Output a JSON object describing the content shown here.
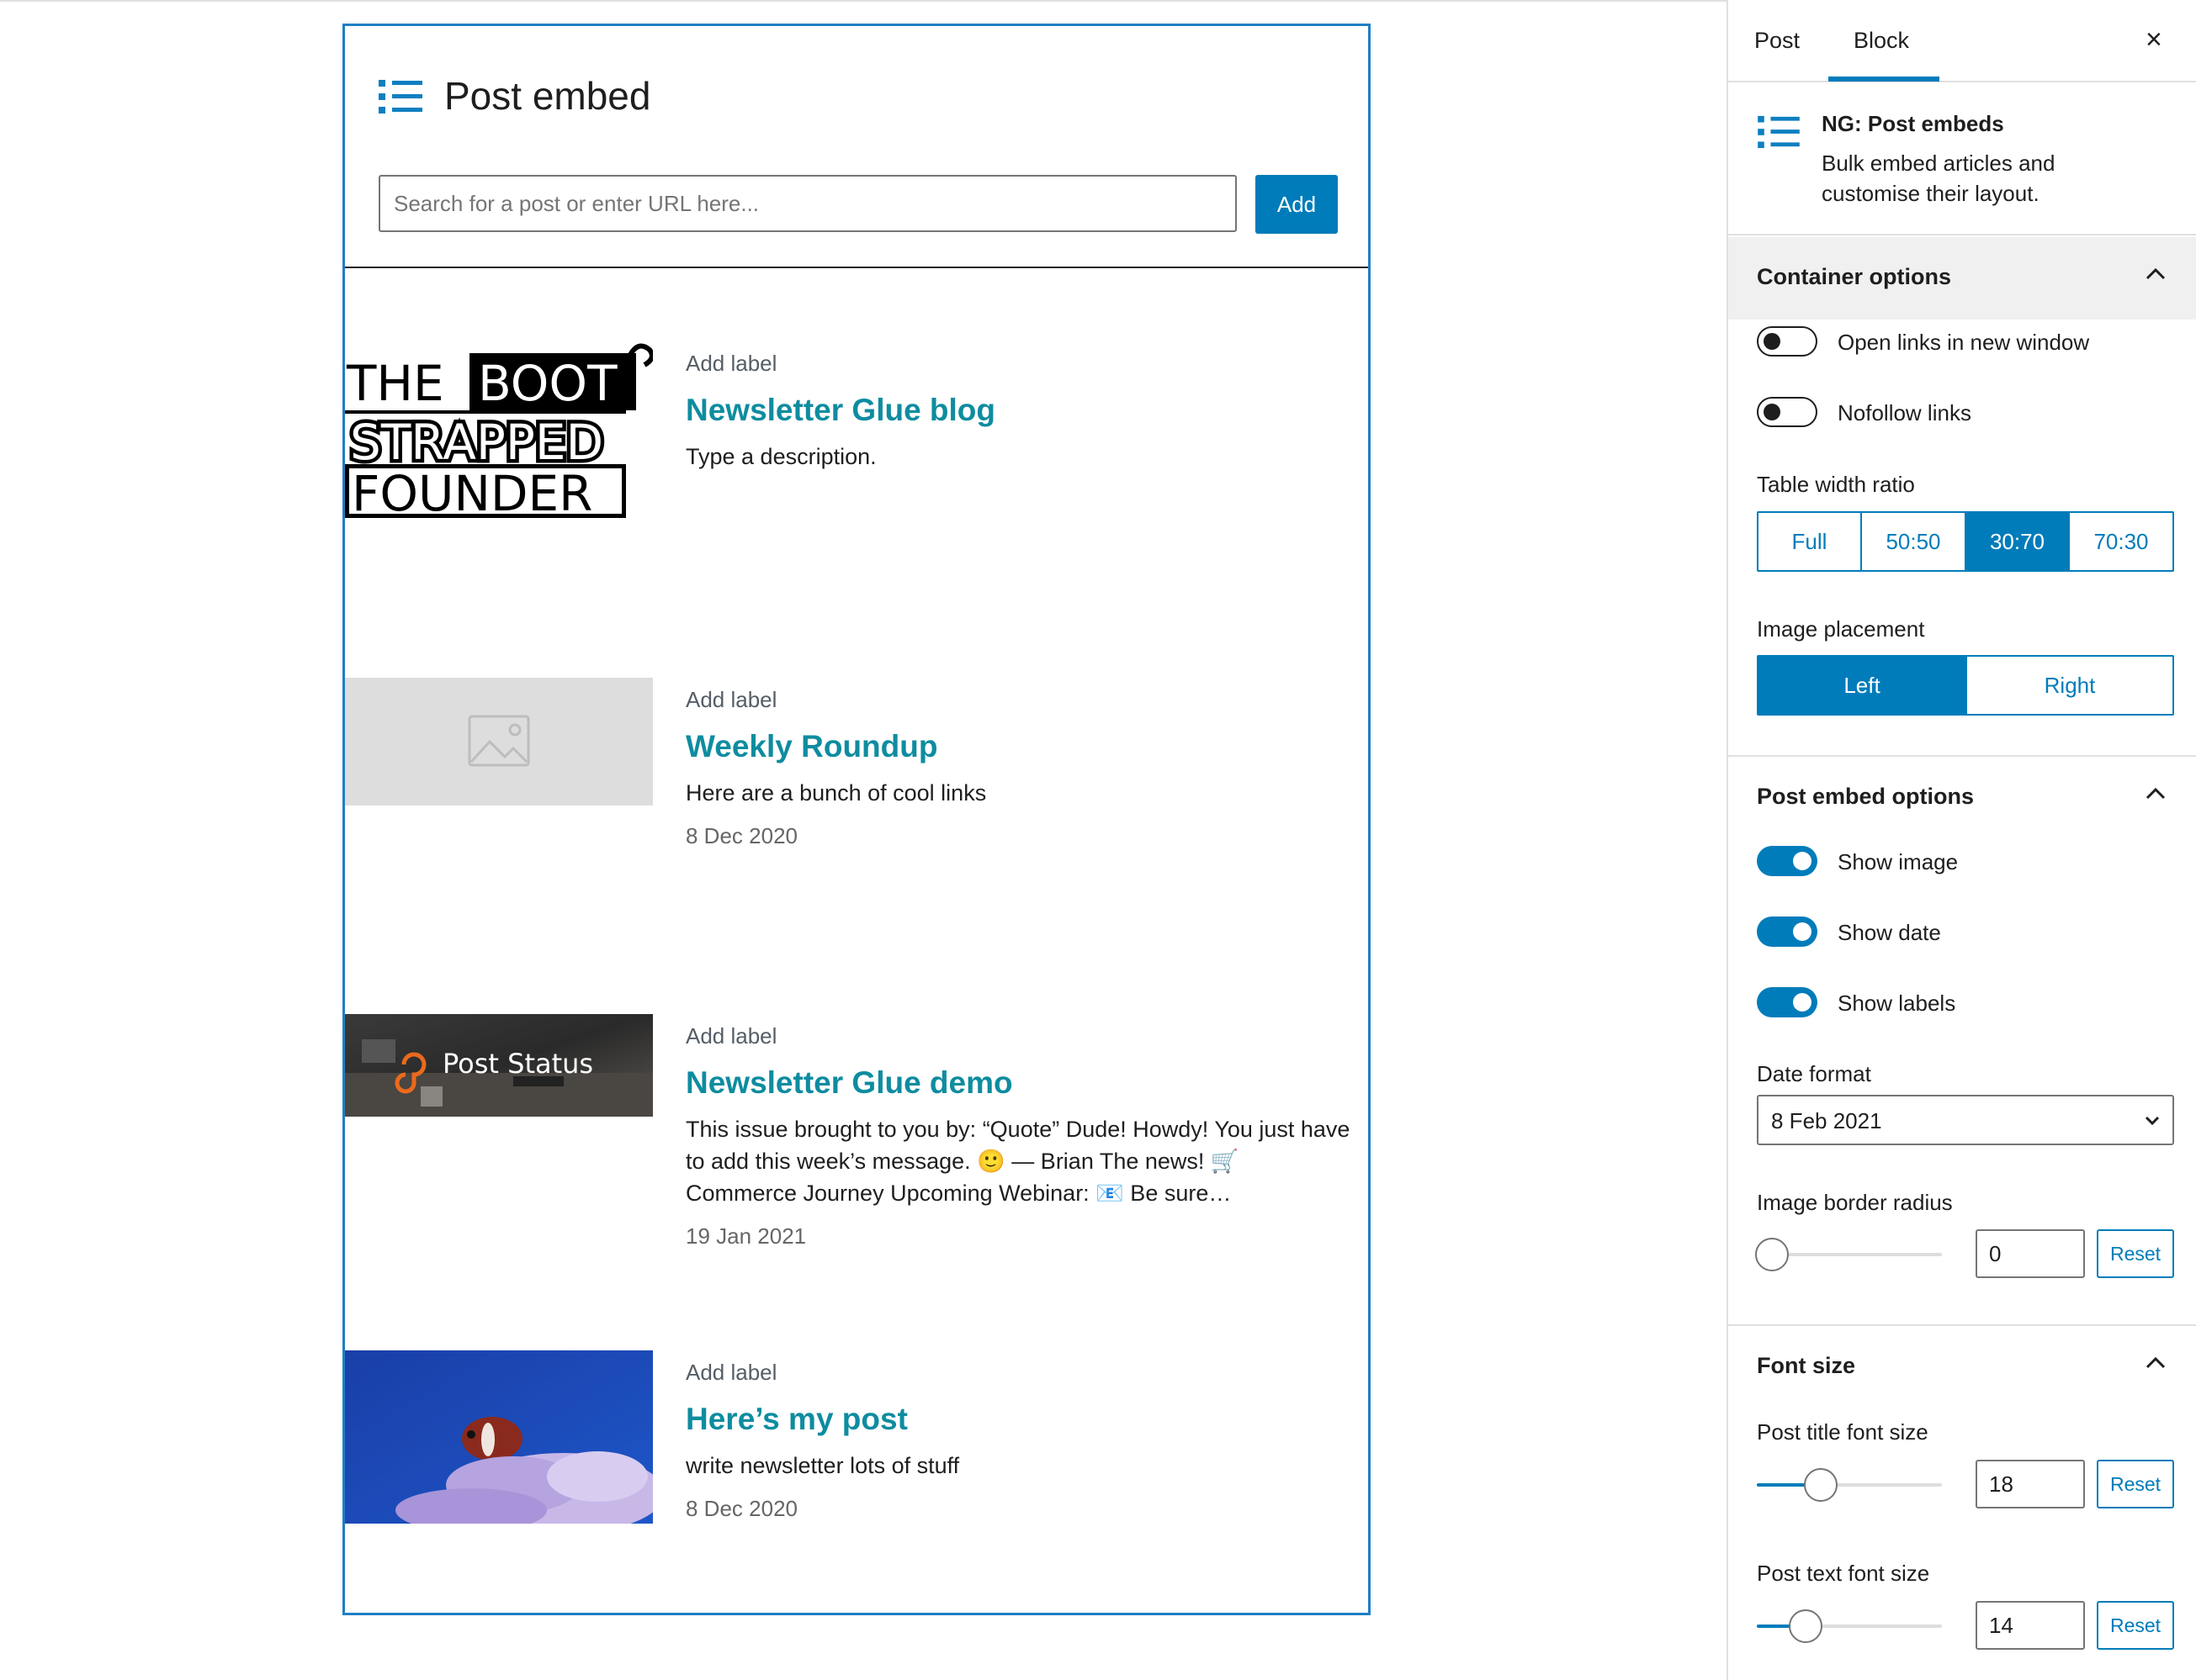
{
  "block": {
    "title": "Post embed",
    "search_placeholder": "Search for a post or enter URL here...",
    "add_label": "Add",
    "posts": [
      {
        "label": "Add label",
        "title": "Newsletter Glue blog",
        "description": "Type a description.",
        "date": "",
        "image": "bootstrapped-founder-logo",
        "logo_words": [
          "THE",
          "BOOT",
          "STRAPPED",
          "FOUNDER"
        ]
      },
      {
        "label": "Add label",
        "title": "Weekly Roundup",
        "description": "Here are a bunch of cool links",
        "date": "8 Dec 2020",
        "image": "image-placeholder-icon"
      },
      {
        "label": "Add label",
        "title": "Newsletter Glue demo",
        "description": "This issue brought to you by: “Quote” Dude! Howdy! You just have to add this week’s message. 🙂 — Brian   The news! 🛒 Commerce Journey Upcoming Webinar: 📧 Be sure…",
        "date": "19 Jan 2021",
        "image": "post-status-banner",
        "logo_words": [
          "Post Status"
        ]
      },
      {
        "label": "Add label",
        "title": "Here’s my post",
        "description": "write newsletter lots of stuff",
        "date": "8 Dec 2020",
        "image": "clownfish-photo"
      }
    ]
  },
  "sidebar": {
    "tabs": [
      "Post",
      "Block"
    ],
    "active_tab": "Block",
    "close": "×",
    "block_card": {
      "title": "NG: Post embeds",
      "description": "Bulk embed articles and customise their layout."
    },
    "container_options": {
      "title": "Container options",
      "toggles": [
        {
          "label": "Open links in new window",
          "on": false
        },
        {
          "label": "Nofollow links",
          "on": false
        }
      ],
      "table_width_label": "Table width ratio",
      "table_width_options": [
        "Full",
        "50:50",
        "30:70",
        "70:30"
      ],
      "table_width_selected": "30:70",
      "image_placement_label": "Image placement",
      "image_placement_options": [
        "Left",
        "Right"
      ],
      "image_placement_selected": "Left"
    },
    "post_embed_options": {
      "title": "Post embed options",
      "toggles": [
        {
          "label": "Show image",
          "on": true
        },
        {
          "label": "Show date",
          "on": true
        },
        {
          "label": "Show labels",
          "on": true
        }
      ],
      "date_format_label": "Date format",
      "date_format_value": "8 Feb 2021",
      "border_radius_label": "Image border radius",
      "border_radius_value": "0",
      "reset_label": "Reset"
    },
    "font_size": {
      "title": "Font size",
      "title_font_label": "Post title font size",
      "title_font_value": "18",
      "text_font_label": "Post text font size",
      "text_font_value": "14",
      "reset_label": "Reset"
    }
  },
  "colors": {
    "accent": "#007cba",
    "title_link": "#0e8ca0",
    "block_border": "#1e7fc4"
  }
}
